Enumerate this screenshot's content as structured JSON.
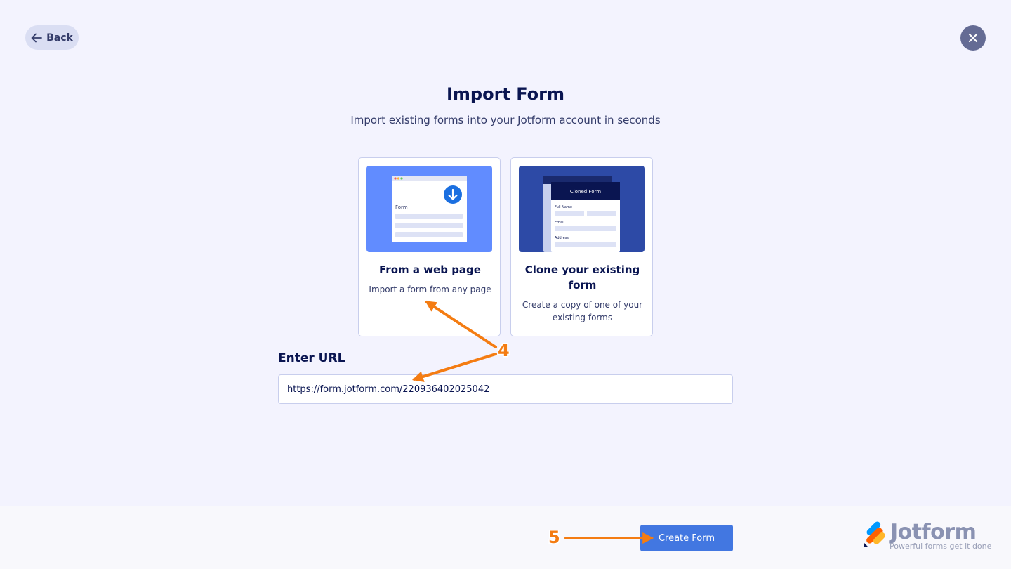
{
  "header": {
    "back_label": "Back"
  },
  "page": {
    "title": "Import Form",
    "subtitle": "Import existing forms into your Jotform account in seconds"
  },
  "cards": [
    {
      "title": "From a web page",
      "description": "Import a form from any page",
      "illustration": {
        "form_label": "Form",
        "icon": "download-icon"
      }
    },
    {
      "title": "Clone your existing form",
      "description": "Create a copy of one of your existing forms",
      "illustration": {
        "header": "Cloned Form",
        "fields": [
          "Full Name",
          "Email",
          "Address"
        ]
      }
    }
  ],
  "url": {
    "label": "Enter URL",
    "value": "https://form.jotform.com/220936402025042"
  },
  "footer": {
    "create_label": "Create Form",
    "brand": "Jotform",
    "tagline": "Powerful forms get it done"
  },
  "annotations": {
    "step_4": "4",
    "step_5": "5"
  },
  "colors": {
    "accent": "#4277e1",
    "annotation": "#f47c12",
    "background": "#f3f3fe",
    "navy": "#0a1551"
  }
}
